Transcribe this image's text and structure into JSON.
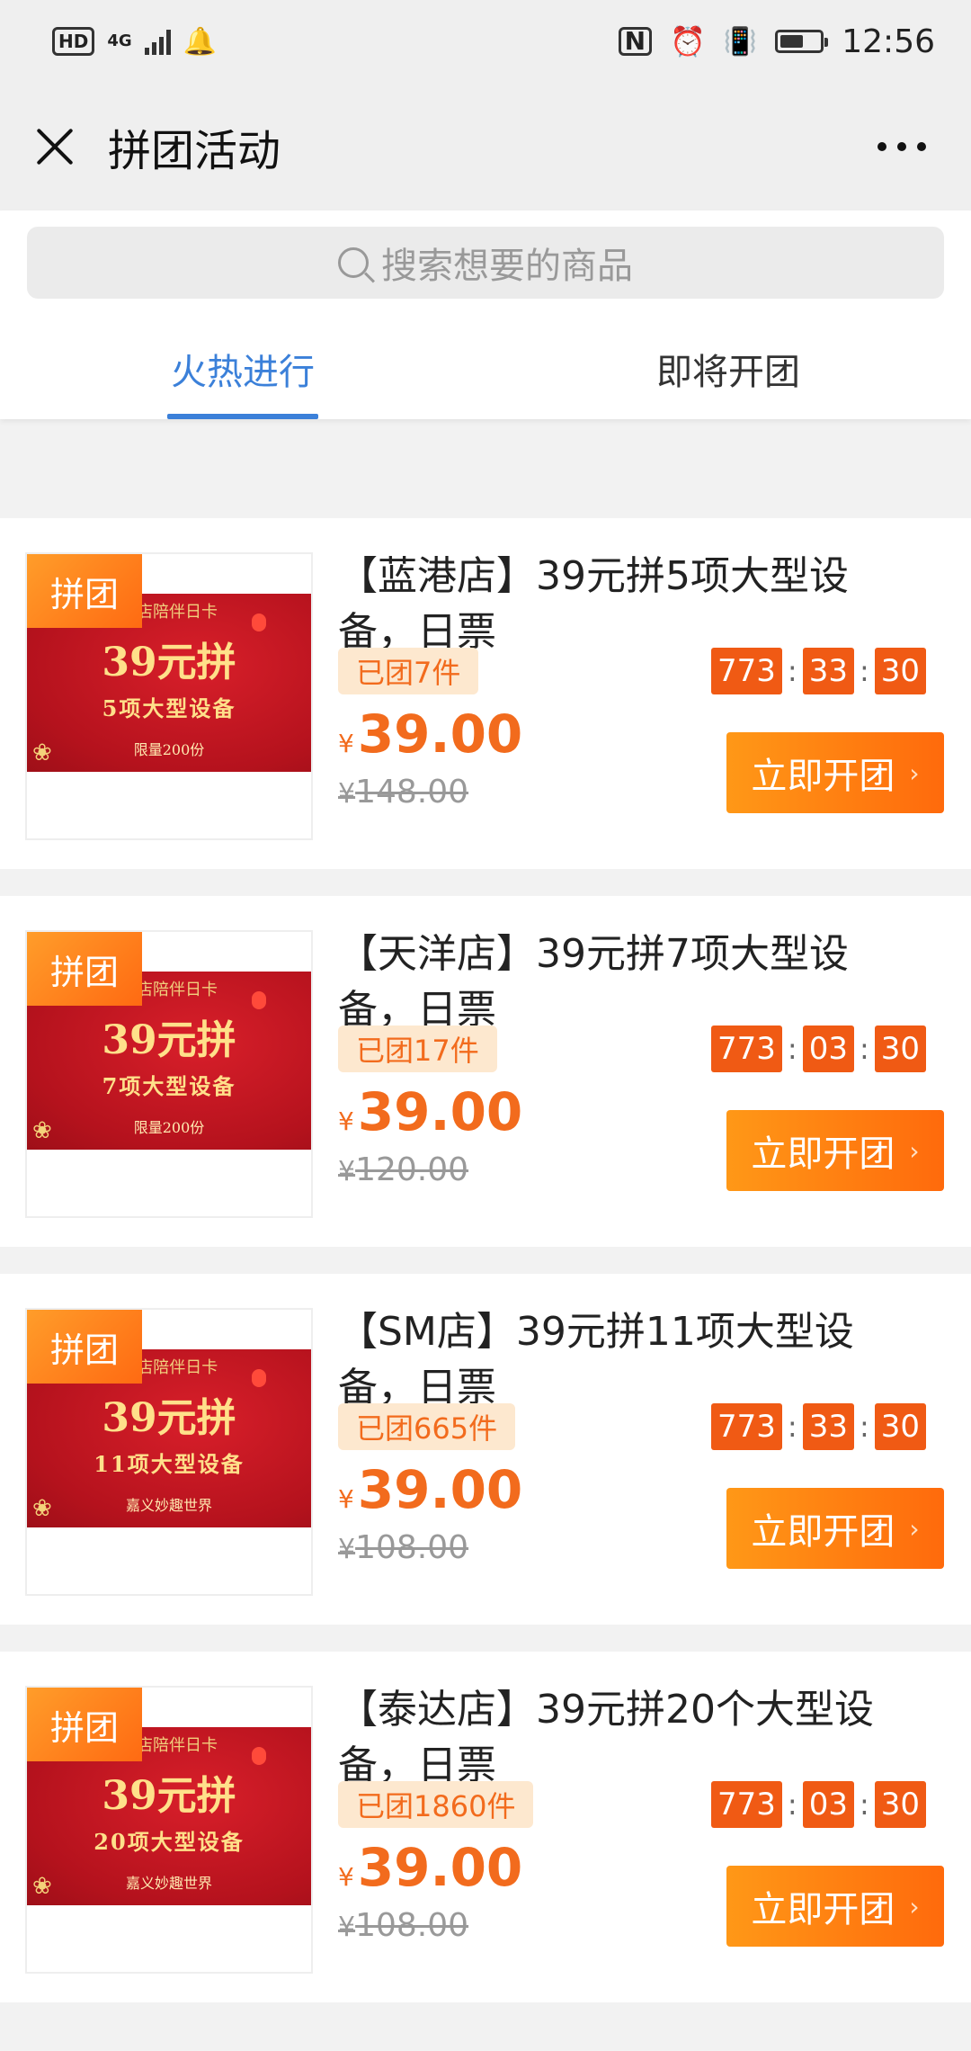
{
  "status_bar": {
    "hd": "HD",
    "network": "4G",
    "time": "12:56",
    "battery_level": 0.6
  },
  "header": {
    "title": "拼团活动"
  },
  "search": {
    "placeholder": "搜索想要的商品"
  },
  "tabs": [
    {
      "label": "火热进行",
      "active": true
    },
    {
      "label": "即将开团",
      "active": false
    }
  ],
  "products": [
    {
      "tag": "拼团",
      "title": "【蓝港店】39元拼5项大型设备，日票",
      "sold": "已团7件",
      "countdown": [
        "773",
        "33",
        "30"
      ],
      "currency": "¥",
      "price": "39.00",
      "original_price": "148.00",
      "button": "立即开团",
      "poster": {
        "top": "港店陪伴日卡",
        "price": "39元拼",
        "items": "5项大型设备",
        "foot": "限量200份"
      }
    },
    {
      "tag": "拼团",
      "title": "【天洋店】39元拼7项大型设备，日票",
      "sold": "已团17件",
      "countdown": [
        "773",
        "03",
        "30"
      ],
      "currency": "¥",
      "price": "39.00",
      "original_price": "120.00",
      "button": "立即开团",
      "poster": {
        "top": "洋店陪伴日卡",
        "price": "39元拼",
        "items": "7项大型设备",
        "foot": "限量200份"
      }
    },
    {
      "tag": "拼团",
      "title": "【SM店】39元拼11项大型设备，日票",
      "sold": "已团665件",
      "countdown": [
        "773",
        "33",
        "30"
      ],
      "currency": "¥",
      "price": "39.00",
      "original_price": "108.00",
      "button": "立即开团",
      "poster": {
        "top": "M店陪伴日卡",
        "price": "39元拼",
        "items": "11项大型设备",
        "foot": "嘉义妙趣世界"
      }
    },
    {
      "tag": "拼团",
      "title": "【泰达店】39元拼20个大型设备，日票",
      "sold": "已团1860件",
      "countdown": [
        "773",
        "03",
        "30"
      ],
      "currency": "¥",
      "price": "39.00",
      "original_price": "108.00",
      "button": "立即开团",
      "poster": {
        "top": "达店陪伴日卡",
        "price": "39元拼",
        "items": "20项大型设备",
        "foot": "嘉义妙趣世界"
      }
    }
  ],
  "colors": {
    "accent_blue": "#3b80d9",
    "accent_orange": "#f26b1d",
    "button_start": "#ff9817",
    "button_end": "#ff6a0c"
  }
}
